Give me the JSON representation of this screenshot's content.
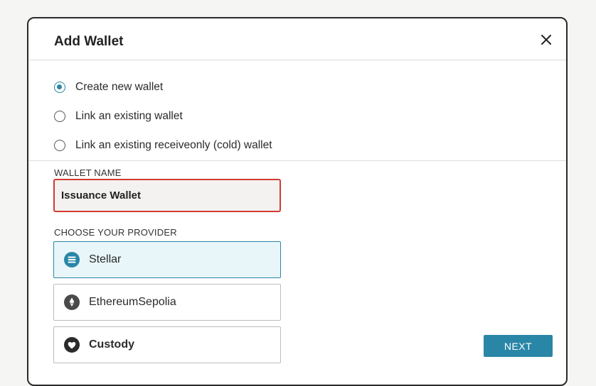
{
  "dialog": {
    "title": "Add Wallet",
    "close_icon": "close-icon"
  },
  "wallet_options": [
    {
      "label": "Create new wallet",
      "checked": true
    },
    {
      "label": "Link an existing wallet",
      "checked": false
    },
    {
      "label": "Link an existing receiveonly (cold) wallet",
      "checked": false
    }
  ],
  "wallet_name": {
    "label": "WALLET NAME",
    "value": "Issuance Wallet"
  },
  "provider": {
    "label": "CHOOSE YOUR PROVIDER",
    "options": [
      {
        "label": "Stellar",
        "icon": "stellar-icon",
        "selected": true
      },
      {
        "label": "EthereumSepolia",
        "icon": "ethereum-icon",
        "selected": false
      },
      {
        "label": "Custody",
        "icon": "custody-icon",
        "selected": false
      }
    ]
  },
  "actions": {
    "next_label": "NEXT"
  },
  "colors": {
    "accent": "#2a86a6",
    "error_border": "#d23a30",
    "selected_bg": "#e9f6f9"
  }
}
